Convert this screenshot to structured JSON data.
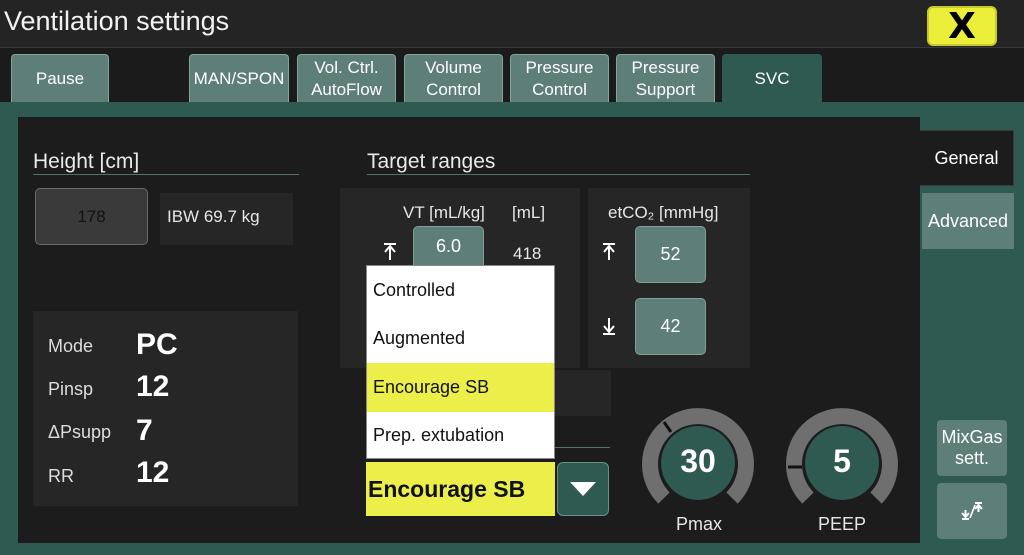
{
  "window": {
    "title": "Ventilation settings",
    "close_label": "X"
  },
  "tabs": [
    {
      "label": "Pause"
    },
    {
      "label": "MAN/SPON"
    },
    {
      "label": "Vol. Ctrl.\nAutoFlow"
    },
    {
      "label": "Volume\nControl"
    },
    {
      "label": "Pressure\nControl"
    },
    {
      "label": "Pressure\nSupport"
    },
    {
      "label": "SVC",
      "active": true
    }
  ],
  "side_tabs": {
    "general": "General",
    "advanced": "Advanced",
    "mixgas": "MixGas\nsett."
  },
  "height": {
    "label": "Height [cm]",
    "value": "178",
    "ibw": "IBW 69.7 kg"
  },
  "current_params": [
    {
      "label": "Mode",
      "value": "PC"
    },
    {
      "label": "Pinsp",
      "value": "12"
    },
    {
      "label": "ΔPsupp",
      "value": "7"
    },
    {
      "label": "RR",
      "value": "12"
    }
  ],
  "target_ranges": {
    "label": "Target ranges",
    "vt_label": "VT [mL/kg]",
    "ml_label": "[mL]",
    "vt_upper": "6.0",
    "vt_upper_ml": "418",
    "etco2_label": "etCO₂ [mmHg]",
    "etco2_upper": "52",
    "etco2_lower": "42",
    "upper_icon": "upper-limit-icon",
    "lower_icon": "lower-limit-icon"
  },
  "mode_dropdown": {
    "options": [
      "Controlled",
      "Augmented",
      "Encourage SB",
      "Prep. extubation"
    ],
    "selected": "Encourage SB"
  },
  "gauges": [
    {
      "label": "Pmax",
      "value": "30"
    },
    {
      "label": "PEEP",
      "value": "5"
    }
  ],
  "colors": {
    "accent": "#2e5a52",
    "button": "#5e7f77",
    "highlight": "#ecef4a",
    "close": "#ecef3a"
  }
}
